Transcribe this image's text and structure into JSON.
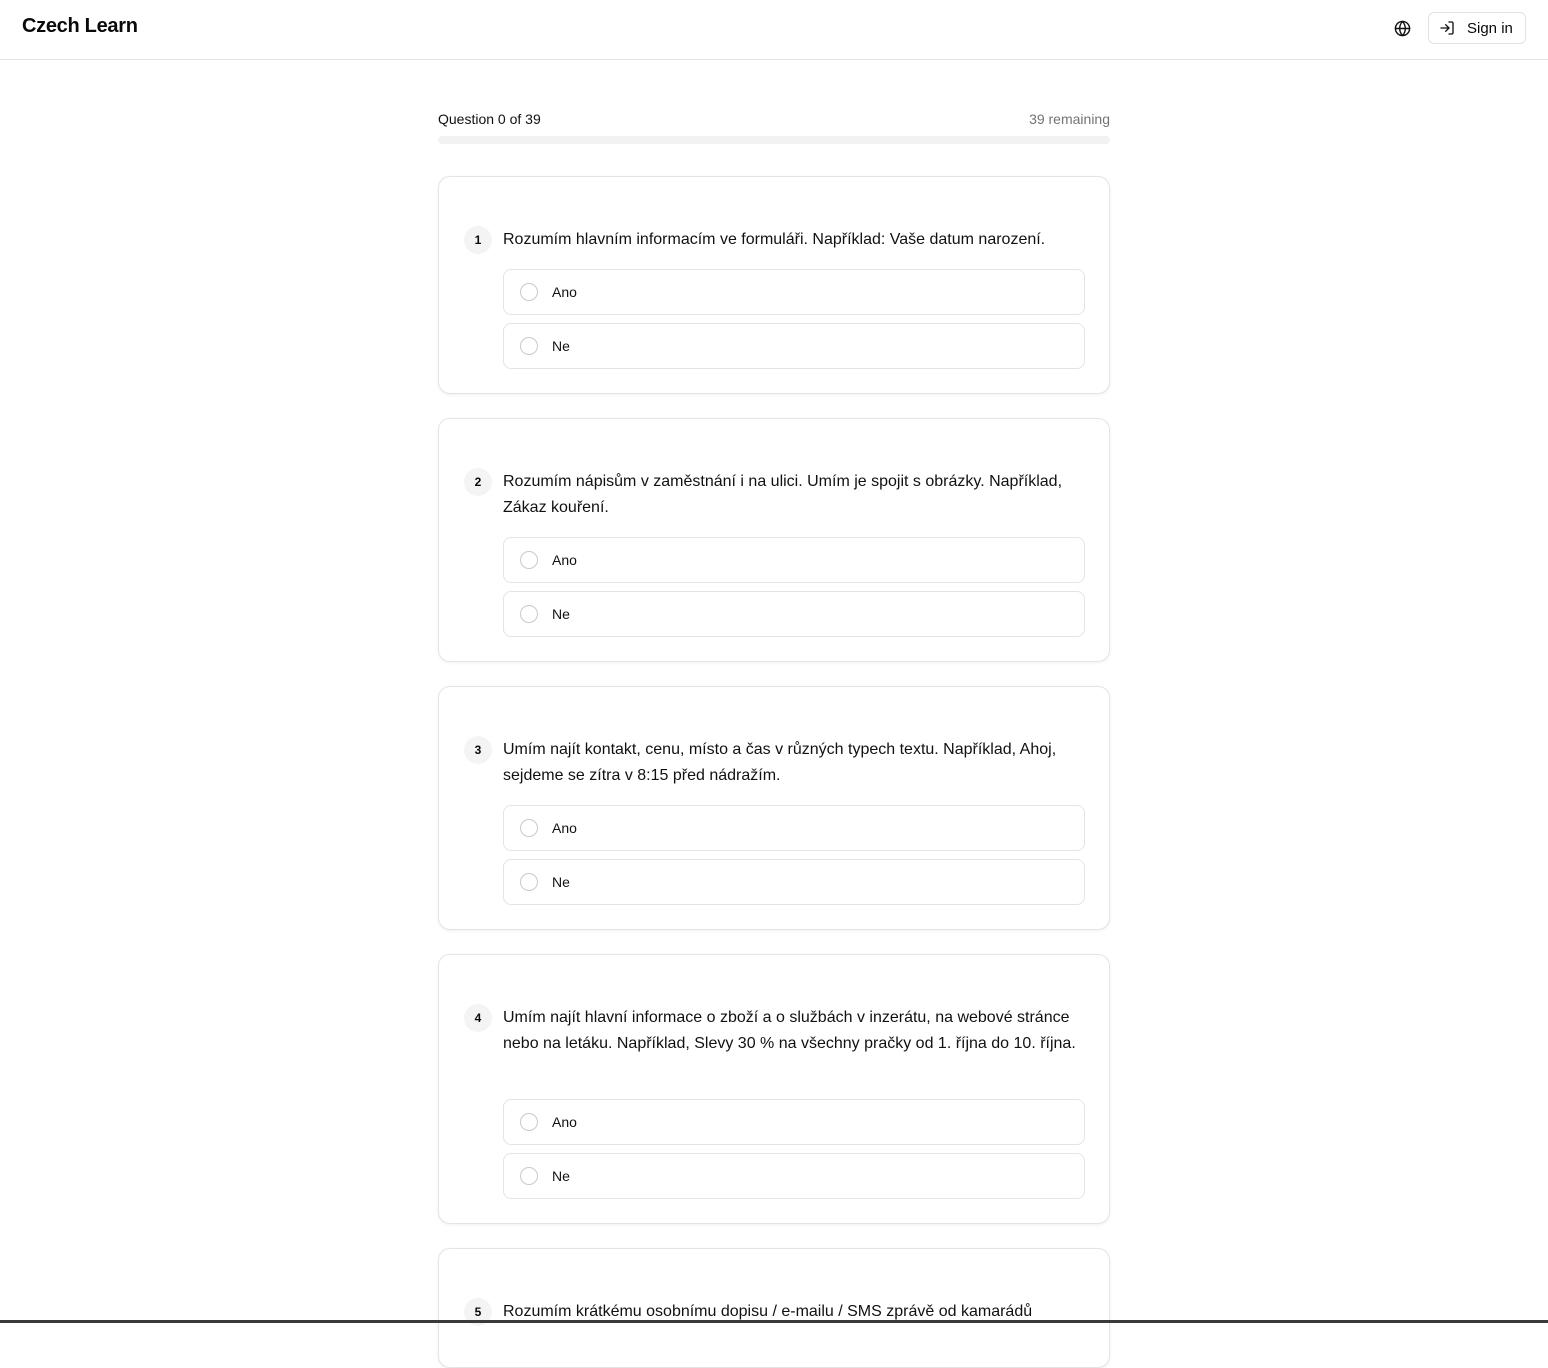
{
  "header": {
    "brand": "Czech Learn",
    "language_icon": "globe-icon",
    "signin_icon": "sign-in-icon",
    "signin_label": "Sign in"
  },
  "progress": {
    "label": "Question 0 of 39",
    "remaining": "39 remaining",
    "fraction": 0
  },
  "questions": [
    {
      "number": "1",
      "text": "Rozumím hlavním informacím ve formuláři. Například: Vaše datum narození.",
      "options": [
        "Ano",
        "Ne"
      ]
    },
    {
      "number": "2",
      "text": "Rozumím nápisům v zaměstnání i na ulici. Umím je spojit s obrázky. Například, Zákaz kouření.",
      "options": [
        "Ano",
        "Ne"
      ]
    },
    {
      "number": "3",
      "text": "Umím najít kontakt, cenu, místo a čas v různých typech textu. Například, Ahoj, sejdeme se zítra v 8:15 před nádražím.",
      "options": [
        "Ano",
        "Ne"
      ]
    },
    {
      "number": "4",
      "text": "Umím najít hlavní informace o zboží a o službách v inzerátu, na webové stránce nebo na letáku. Například, Slevy 30 % na všechny pračky od 1. října do 10. října.",
      "options": [
        "Ano",
        "Ne"
      ]
    },
    {
      "number": "5",
      "text": "Rozumím krátkému osobnímu dopisu / e-mailu / SMS zprávě od kamarádů",
      "options": []
    }
  ]
}
